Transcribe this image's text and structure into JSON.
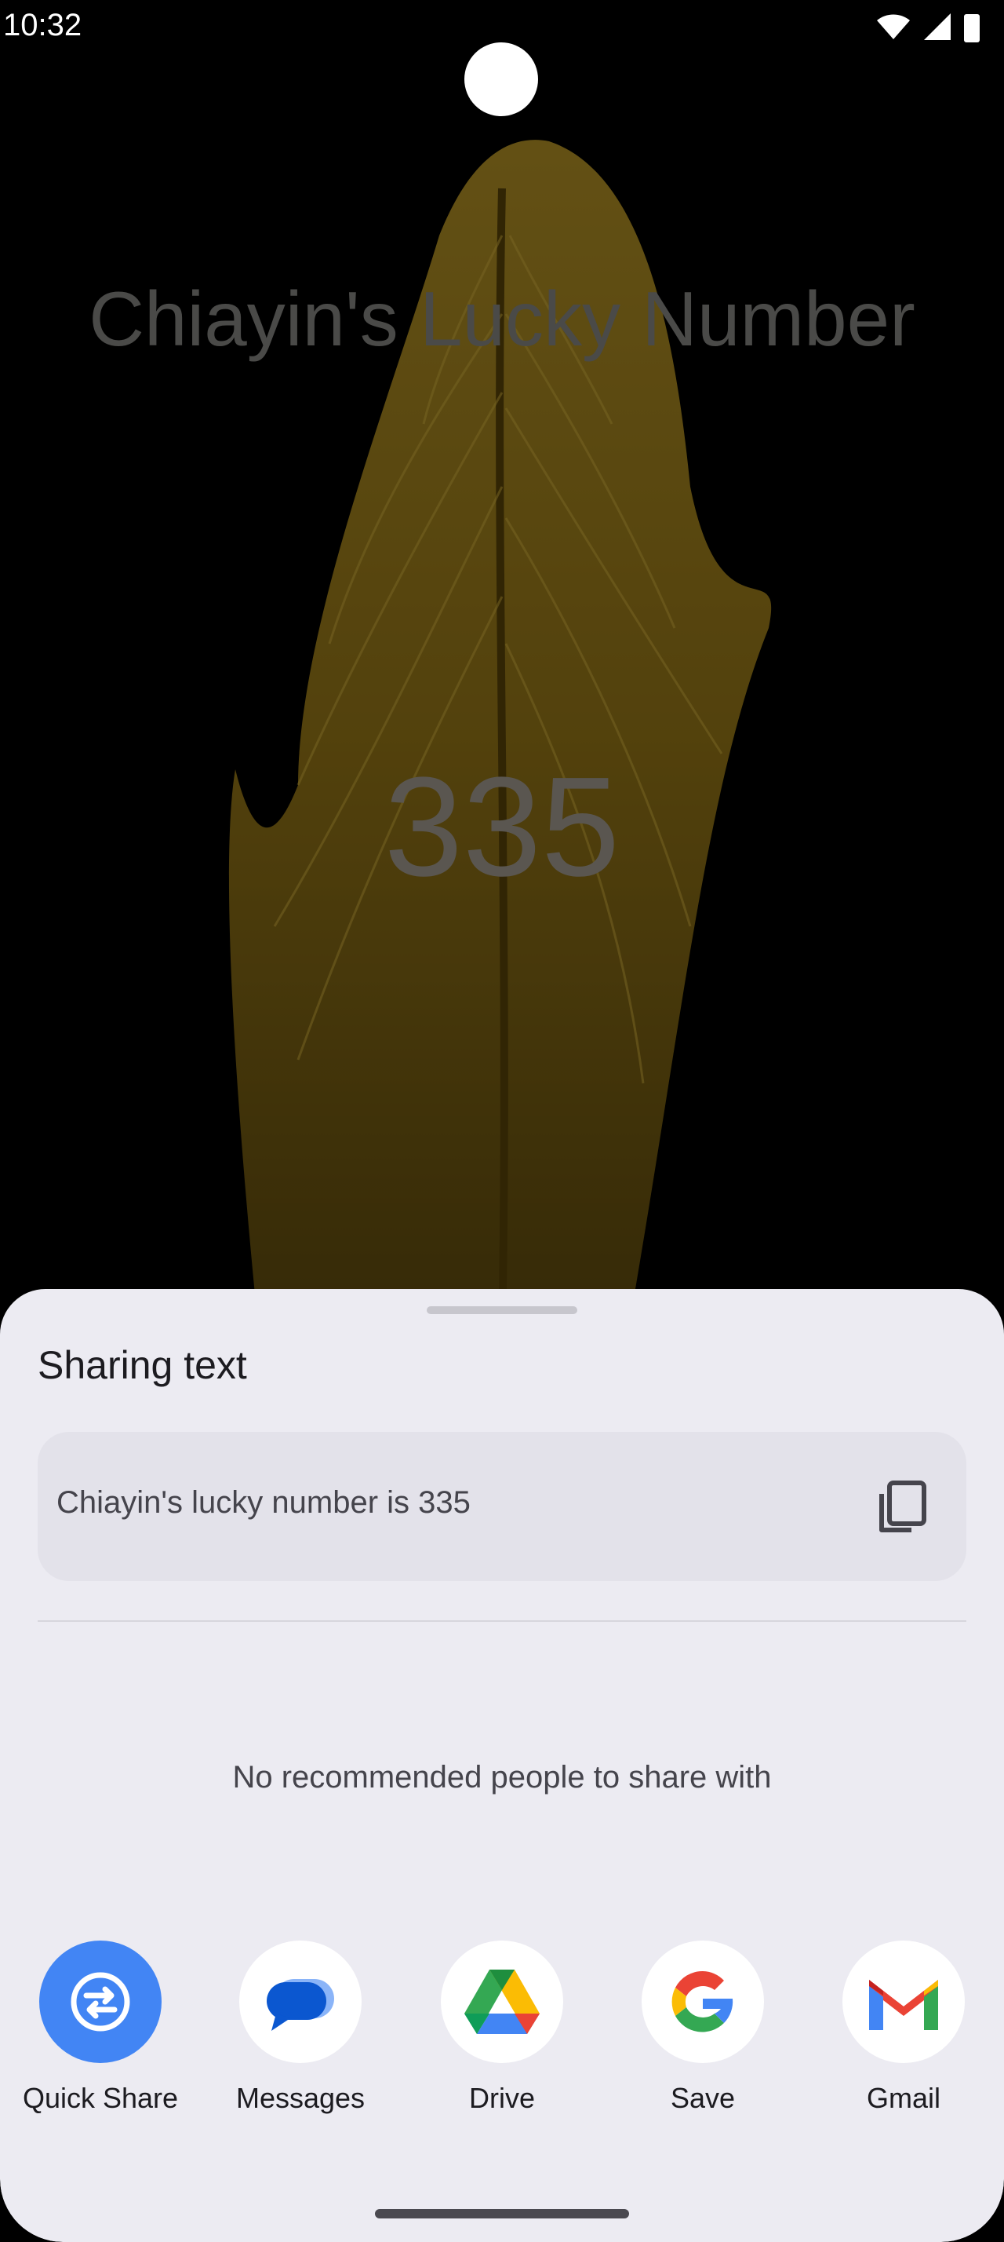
{
  "status_bar": {
    "time": "10:32"
  },
  "app": {
    "title": "Chiayin's Lucky Number",
    "number": "335"
  },
  "share_sheet": {
    "title": "Sharing text",
    "preview_text": "Chiayin's lucky number is 335",
    "empty_people_message": "No recommended people to share with",
    "targets": [
      {
        "label": "Quick Share",
        "icon": "quick-share-icon"
      },
      {
        "label": "Messages",
        "icon": "messages-icon"
      },
      {
        "label": "Drive",
        "icon": "drive-icon"
      },
      {
        "label": "Save",
        "icon": "google-icon"
      },
      {
        "label": "Gmail",
        "icon": "gmail-icon"
      }
    ]
  },
  "colors": {
    "background": "#000000",
    "sheet": "#ecebf2",
    "feather": "#b8921e",
    "quick_share": "#4285f4"
  }
}
